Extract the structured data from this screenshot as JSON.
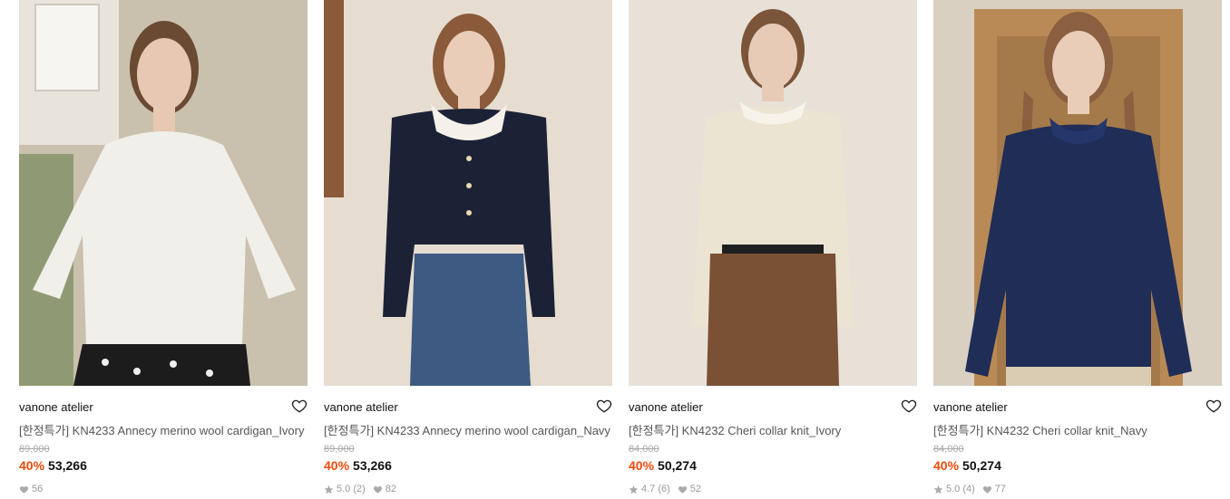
{
  "products": [
    {
      "brand": "vanone atelier",
      "title": "[한정특가] KN4233 Annecy merino wool cardigan_Ivory",
      "original_price": "89,000",
      "discount": "40%",
      "price": "53,266",
      "rating": "",
      "likes": "56",
      "palette": {
        "bg": "#c9c1ad",
        "bg2": "#8f9a74",
        "garment": "#f1efe9",
        "skin": "#e7c8b3",
        "hair": "#6a4a33",
        "bottom": "#1c1c1c"
      }
    },
    {
      "brand": "vanone atelier",
      "title": "[한정특가] KN4233 Annecy merino wool cardigan_Navy",
      "original_price": "89,000",
      "discount": "40%",
      "price": "53,266",
      "rating": "5.0 (2)",
      "likes": "82",
      "palette": {
        "bg": "#e6ddd0",
        "bg2": "#d9cfbf",
        "garment": "#1c2236",
        "skin": "#e9cdb8",
        "hair": "#8a5a3a",
        "bottom": "#3d5a82"
      }
    },
    {
      "brand": "vanone atelier",
      "title": "[한정특가] KN4232 Cheri collar knit_Ivory",
      "original_price": "84,000",
      "discount": "40%",
      "price": "50,274",
      "rating": "4.7 (6)",
      "likes": "52",
      "palette": {
        "bg": "#e7e1d8",
        "bg2": "#ddd6cb",
        "garment": "#ece4d3",
        "skin": "#e8cbb7",
        "hair": "#7a553a",
        "bottom": "#7a5134"
      }
    },
    {
      "brand": "vanone atelier",
      "title": "[한정특가] KN4232 Cheri collar knit_Navy",
      "original_price": "84,000",
      "discount": "40%",
      "price": "50,274",
      "rating": "5.0 (4)",
      "likes": "77",
      "palette": {
        "bg": "#d9d0c2",
        "bg2": "#b98a55",
        "garment": "#1f2d57",
        "skin": "#e9cdb8",
        "hair": "#8a6040",
        "bottom": "#d9ccb3"
      }
    }
  ],
  "colors": {
    "discount": "#f24a0c",
    "muted": "#999999"
  },
  "icons": {
    "wishlist": "heart-outline-icon",
    "rating": "star-icon",
    "likes": "heart-filled-icon"
  }
}
